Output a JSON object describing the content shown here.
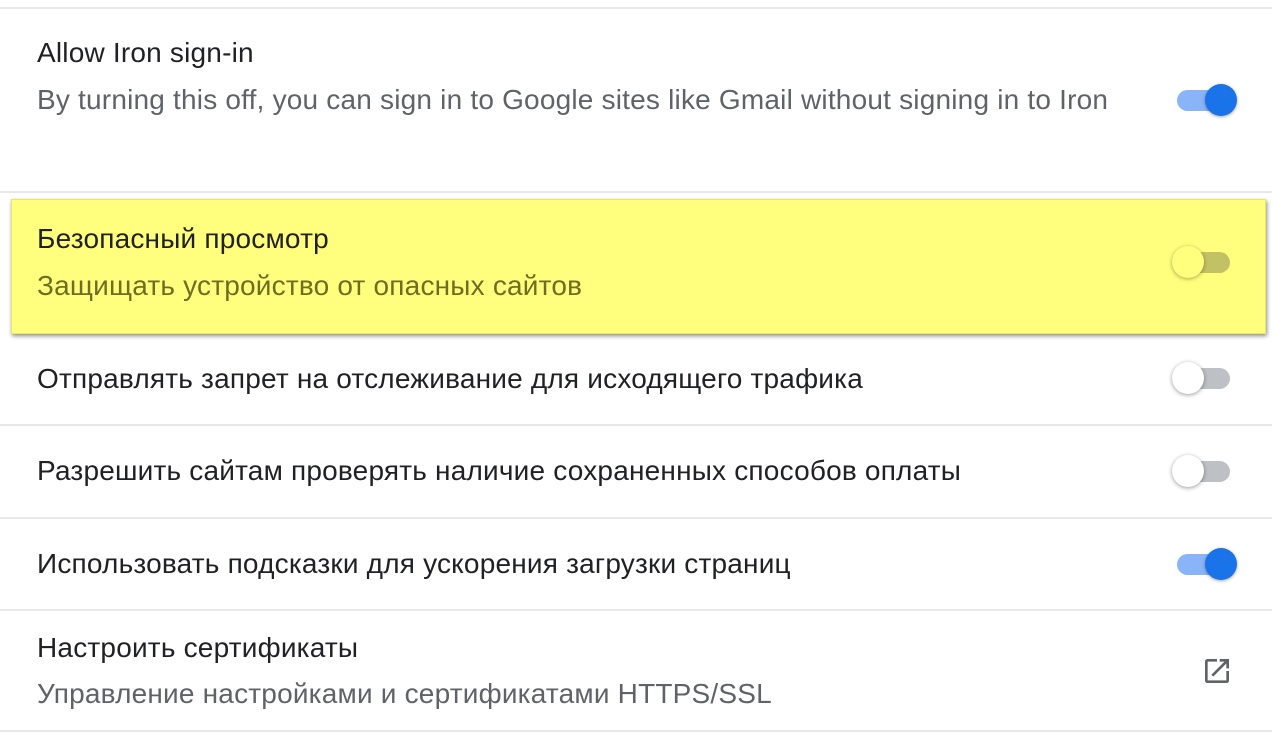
{
  "settings": {
    "iron_signin": {
      "title": "Allow Iron sign-in",
      "subtitle": "By turning this off, you can sign in to Google sites like Gmail without signing in to Iron",
      "enabled": true
    },
    "safe_browsing": {
      "title": "Безопасный просмотр",
      "subtitle": "Защищать устройство от опасных сайтов",
      "enabled": false,
      "highlighted": true
    },
    "do_not_track": {
      "title": "Отправлять запрет на отслеживание для исходящего трафика",
      "enabled": false
    },
    "payment_methods": {
      "title": "Разрешить сайтам проверять наличие сохраненных способов оплаты",
      "enabled": false
    },
    "preload_pages": {
      "title": "Использовать подсказки для ускорения загрузки страниц",
      "enabled": true
    },
    "certificates": {
      "title": "Настроить сертификаты",
      "subtitle": "Управление настройками и сертификатами HTTPS/SSL",
      "icon": "open-in-new-icon"
    }
  },
  "colors": {
    "toggle_on_track": "#8ab4f8",
    "toggle_on_knob": "#1a73e8",
    "toggle_off_track": "#bdc1c6",
    "highlight": "#ffff7d"
  }
}
